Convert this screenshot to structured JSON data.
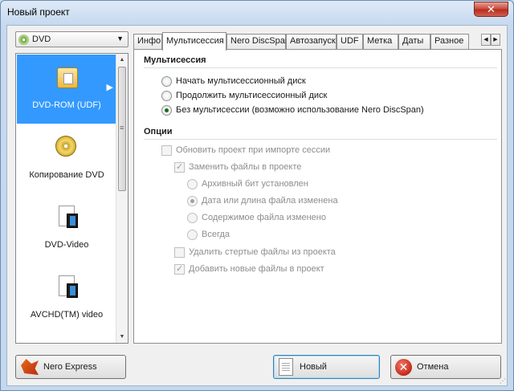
{
  "window": {
    "title": "Новый проект",
    "close_glyph": "✕"
  },
  "format_dropdown": {
    "value": "DVD"
  },
  "categories": [
    {
      "label": "DVD-ROM (UDF)",
      "icon": "dvd-rom-icon",
      "selected": true
    },
    {
      "label": "Копирование DVD",
      "icon": "copy-dvd-icon",
      "selected": false
    },
    {
      "label": "DVD-Video",
      "icon": "dvd-video-icon",
      "selected": false
    },
    {
      "label": "AVCHD(TM) video",
      "icon": "avchd-video-icon",
      "selected": false
    }
  ],
  "tabs": [
    {
      "label": "Инфо",
      "active": false
    },
    {
      "label": "Мультисессия",
      "active": true
    },
    {
      "label": "Nero DiscSpan",
      "active": false
    },
    {
      "label": "Автозапуск",
      "active": false
    },
    {
      "label": "UDF",
      "active": false
    },
    {
      "label": "Метка",
      "active": false
    },
    {
      "label": "Даты",
      "active": false
    },
    {
      "label": "Разное",
      "active": false
    }
  ],
  "multisession": {
    "title": "Мультисессия",
    "options": [
      {
        "label": "Начать мультисессионный диск",
        "checked": false
      },
      {
        "label": "Продолжить мультисессионный диск",
        "checked": false
      },
      {
        "label": "Без мультисессии (возможно использование Nero DiscSpan)",
        "checked": true
      }
    ]
  },
  "options": {
    "title": "Опции",
    "update_on_import": {
      "label": "Обновить проект при импорте сессии",
      "checked": false,
      "enabled": false
    },
    "replace_files": {
      "label": "Заменить файлы в проекте",
      "checked": true,
      "enabled": false
    },
    "replace_modes": [
      {
        "label": "Архивный бит установлен",
        "checked": false
      },
      {
        "label": "Дата или длина файла изменена",
        "checked": true
      },
      {
        "label": "Содержимое файла изменено",
        "checked": false
      },
      {
        "label": "Всегда",
        "checked": false
      }
    ],
    "delete_erased": {
      "label": "Удалить стертые файлы из проекта",
      "checked": false,
      "enabled": false
    },
    "add_new": {
      "label": "Добавить новые файлы в проект",
      "checked": true,
      "enabled": false
    }
  },
  "buttons": {
    "nero_express": "Nero Express",
    "new": "Новый",
    "cancel": "Отмена"
  }
}
